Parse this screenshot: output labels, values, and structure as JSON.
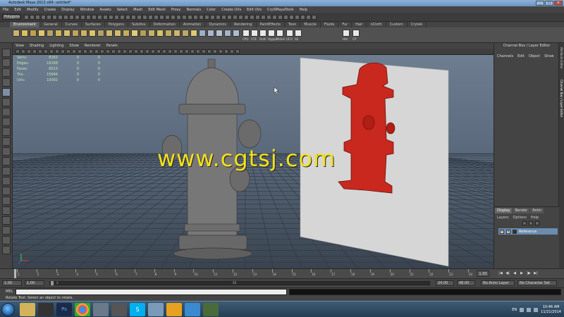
{
  "window": {
    "title": "Autodesk Maya 2013 x64: untitled*",
    "controls": {
      "minimize": "_",
      "maximize": "□",
      "close": "×"
    }
  },
  "menu": [
    "File",
    "Edit",
    "Modify",
    "Create",
    "Display",
    "Window",
    "Assets",
    "Select",
    "Mesh",
    "Edit Mesh",
    "Proxy",
    "Normals",
    "Color",
    "Create UVs",
    "Edit UVs",
    "CrySMayaTools",
    "Help"
  ],
  "mode_select": "Polygons",
  "shelf_tabs": [
    "Environment",
    "General",
    "Curves",
    "Surfaces",
    "Polygons",
    "Subdivs",
    "Deformation",
    "Animation",
    "Dynamics",
    "Rendering",
    "PaintEffects",
    "Toon",
    "Muscle",
    "Fluids",
    "Fur",
    "Hair",
    "nCloth",
    "Custom",
    "Crytek"
  ],
  "shelf_active_tab": "Environment",
  "shelf_labels": [
    "CPO",
    "UTE",
    "Outli",
    "Hyppo",
    "MoSel",
    "UCO",
    "AE",
    "HIsl",
    "CP"
  ],
  "viewport_menu": [
    "View",
    "Shading",
    "Lighting",
    "Show",
    "Renderer",
    "Panels"
  ],
  "hud_stats": [
    {
      "label": "Verts:",
      "value": "8262",
      "selected": "0",
      "components": "0"
    },
    {
      "label": "Edges:",
      "value": "16168",
      "selected": "0",
      "components": "0"
    },
    {
      "label": "Faces:",
      "value": "8013",
      "selected": "0",
      "components": "0"
    },
    {
      "label": "Tris:",
      "value": "15646",
      "selected": "0",
      "components": "0"
    },
    {
      "label": "UVs:",
      "value": "10092",
      "selected": "0",
      "components": "0"
    }
  ],
  "watermark": "www.cgtsj.com",
  "channel_box": {
    "title": "Channel Box / Layer Editor",
    "menu": [
      "Channels",
      "Edit",
      "Object",
      "Show"
    ],
    "side_tabs": [
      "Attribute Editor",
      "Channel Box / Layer Editor"
    ]
  },
  "layer_editor": {
    "tabs": [
      "Display",
      "Render",
      "Anim"
    ],
    "active_tab": "Display",
    "submenu": [
      "Layers",
      "Options",
      "Help"
    ],
    "layer": {
      "visible": "V",
      "ref": "R",
      "name": "Reference"
    }
  },
  "timeline": {
    "ticks": [
      "1",
      "2",
      "3",
      "4",
      "5",
      "6",
      "7",
      "8",
      "9",
      "10",
      "11",
      "12",
      "13",
      "14",
      "15",
      "16",
      "17",
      "18",
      "19",
      "20",
      "21",
      "22",
      "23",
      "24"
    ],
    "current_frame": "1.00"
  },
  "range": {
    "start": "1.00",
    "start_inner": "1.00",
    "start_marker": "1",
    "mid_marker": "25",
    "end_inner": "24.00",
    "end": "48.00",
    "anim_layer": "No Anim Layer",
    "char_set": "No Character Set"
  },
  "command_line": {
    "label": "MEL"
  },
  "help_line": "Rotate Tool: Select an object to rotate.",
  "taskbar": {
    "time": "10:46 AM",
    "date": "11/21/2014",
    "lang": "EN"
  },
  "colors": {
    "maya_bg": "#444444",
    "viewport_top": "#6e7e90",
    "viewport_bottom": "#3a4450",
    "watermark": "#f5e21a",
    "hydrant_red": "#c8281e",
    "layer_row": "#6a8caf"
  }
}
